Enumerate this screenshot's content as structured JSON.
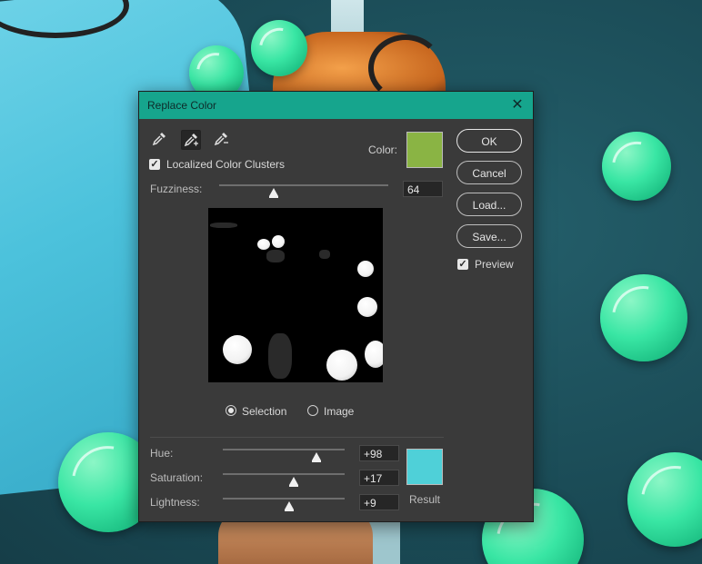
{
  "dialog": {
    "title": "Replace Color",
    "close_glyph": "✕",
    "tools": [
      {
        "name": "eyedropper-icon"
      },
      {
        "name": "eyedropper-add-icon",
        "active": true
      },
      {
        "name": "eyedropper-subtract-icon"
      }
    ],
    "color_label": "Color:",
    "selected_color": "#8ab444",
    "localized_color_clusters": {
      "label": "Localized Color Clusters",
      "checked": true
    },
    "fuzziness": {
      "label": "Fuzziness:",
      "value": "64",
      "fraction": 0.32
    },
    "view_mode": {
      "options": [
        {
          "label": "Selection",
          "selected": true
        },
        {
          "label": "Image",
          "selected": false
        }
      ]
    },
    "replacement": {
      "hue": {
        "label": "Hue:",
        "value": "+98",
        "fraction": 0.77
      },
      "saturation": {
        "label": "Saturation:",
        "value": "+17",
        "fraction": 0.58
      },
      "lightness": {
        "label": "Lightness:",
        "value": "+9",
        "fraction": 0.545
      },
      "result_label": "Result",
      "result_color": "#4fd0d8"
    },
    "buttons": {
      "ok": "OK",
      "cancel": "Cancel",
      "load": "Load...",
      "save": "Save..."
    },
    "preview": {
      "label": "Preview",
      "checked": true
    }
  }
}
